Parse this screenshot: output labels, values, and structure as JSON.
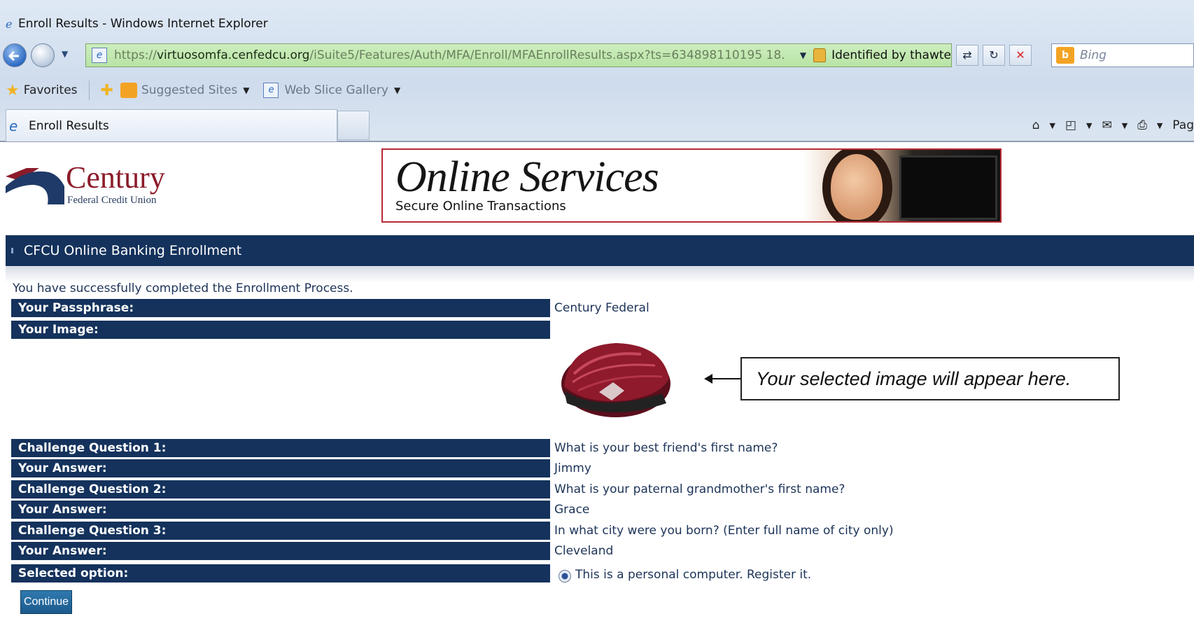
{
  "window": {
    "title": "Enroll Results - Windows Internet Explorer"
  },
  "address_bar": {
    "url_prefix": "https://",
    "url_domain": "virtuosomfa.cenfedcu.org",
    "url_path": "/iSuite5/Features/Auth/MFA/Enroll/MFAEnrollResults.aspx?ts=634898110195 18.",
    "identity": "Identified by thawte"
  },
  "search": {
    "placeholder": "Bing"
  },
  "favorites_bar": {
    "favorites_label": "Favorites",
    "suggested_sites": "Suggested Sites",
    "web_slice_gallery": "Web Slice Gallery"
  },
  "tab": {
    "label": "Enroll Results"
  },
  "command_bar": {
    "page_label": "Pag"
  },
  "logo": {
    "name": "Century",
    "subtitle": "Federal Credit Union"
  },
  "banner": {
    "title": "Online Services",
    "subtitle": "Secure Online Transactions"
  },
  "header": {
    "title": "CFCU Online Banking Enrollment"
  },
  "success_message": "You have successfully completed the Enrollment Process.",
  "results": {
    "passphrase_label": "Your Passphrase:",
    "passphrase_value": "Century Federal",
    "image_label": "Your Image:",
    "q1_label": "Challenge Question 1:",
    "q1_value": "What is your best friend's first name?",
    "a1_label": "Your Answer:",
    "a1_value": "Jimmy",
    "q2_label": "Challenge Question 2:",
    "q2_value": "What is your paternal grandmother's first name?",
    "a2_label": "Your Answer:",
    "a2_value": "Grace",
    "q3_label": "Challenge Question 3:",
    "q3_value": "In what city were you born? (Enter full name of city only)",
    "a3_label": "Your Answer:",
    "a3_value": "Cleveland",
    "option_label": "Selected option:",
    "option_value": "This is a personal computer. Register it."
  },
  "callout": {
    "text": "Your selected image will appear here."
  },
  "continue_button": {
    "label": "Continue"
  },
  "colors": {
    "navy": "#14325c",
    "brand_red": "#8c1b2a",
    "banner_border": "#b62b35",
    "address_green": "#b8e3a5"
  }
}
